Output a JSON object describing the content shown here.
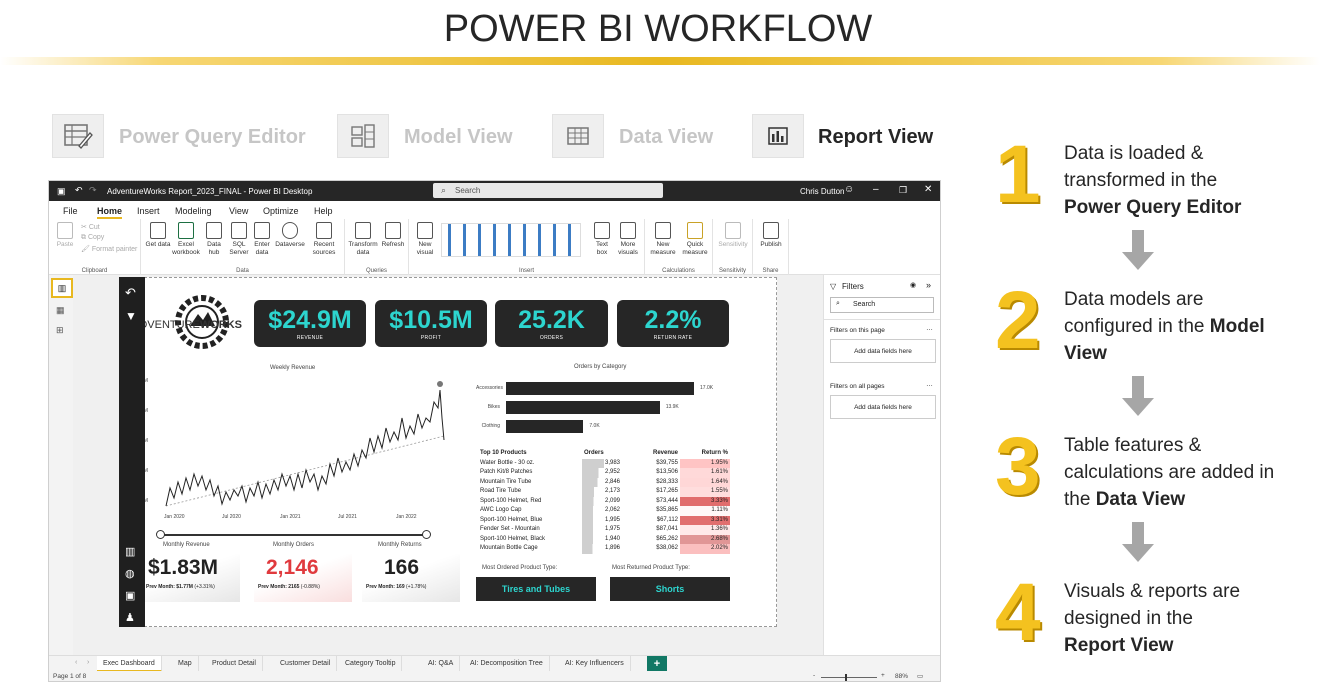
{
  "slide_title": "POWER BI WORKFLOW",
  "stages": [
    {
      "label": "Power Query Editor",
      "icon": "power-query-icon",
      "active": false
    },
    {
      "label": "Model View",
      "icon": "model-view-icon",
      "active": false
    },
    {
      "label": "Data View",
      "icon": "data-view-icon",
      "active": false
    },
    {
      "label": "Report View",
      "icon": "report-view-icon",
      "active": true
    }
  ],
  "steps": [
    {
      "num": "1",
      "pre": "Data is loaded & transformed in the",
      "bold": "Power Query Editor",
      "post": ""
    },
    {
      "num": "2",
      "pre": "Data models are configured in the",
      "bold": "Model View",
      "post": ""
    },
    {
      "num": "3",
      "pre": "Table features & calculations are added in the",
      "bold": "Data View",
      "post": ""
    },
    {
      "num": "4",
      "pre": "Visuals & reports are designed in the",
      "bold": "Report View",
      "post": ""
    }
  ],
  "accent_color": "#F4C21F",
  "window": {
    "title": "AdventureWorks Report_2023_FINAL - Power BI Desktop",
    "search_placeholder": "Search",
    "user": "Chris Dutton",
    "menu_tabs": [
      "File",
      "Home",
      "Insert",
      "Modeling",
      "View",
      "Optimize",
      "Help"
    ],
    "active_menu_tab": "Home",
    "ribbon": {
      "clipboard": {
        "paste": "Paste",
        "cut": "Cut",
        "copy": "Copy",
        "format_painter": "Format painter",
        "name": "Clipboard"
      },
      "data": {
        "buttons": [
          "Get data",
          "Excel workbook",
          "Data hub",
          "SQL Server",
          "Enter data",
          "Dataverse",
          "Recent sources"
        ],
        "name": "Data"
      },
      "queries": {
        "buttons": [
          "Transform data",
          "Refresh"
        ],
        "name": "Queries"
      },
      "insert": {
        "buttons": [
          "New visual",
          "Text box",
          "More visuals"
        ],
        "name": "Insert"
      },
      "calculations": {
        "buttons": [
          "New measure",
          "Quick measure"
        ],
        "name": "Calculations"
      },
      "sensitivity": {
        "buttons": [
          "Sensitivity"
        ],
        "name": "Sensitivity"
      },
      "share": {
        "buttons": [
          "Publish"
        ],
        "name": "Share"
      }
    },
    "report": {
      "logo_text_light": "ADVENTURE",
      "logo_text_bold": "WORKS",
      "kpis": [
        {
          "value": "$24.9M",
          "label": "REVENUE"
        },
        {
          "value": "$10.5M",
          "label": "PROFIT"
        },
        {
          "value": "25.2K",
          "label": "ORDERS"
        },
        {
          "value": "2.2%",
          "label": "RETURN RATE"
        }
      ],
      "weekly_revenue": {
        "title": "Weekly Revenue",
        "y_ticks": [
          "$0.5M",
          "$0.4M",
          "$0.3M",
          "$0.2M",
          "$0.1M"
        ],
        "x_ticks": [
          "Jan 2020",
          "Jul 2020",
          "Jan 2021",
          "Jul 2021",
          "Jan 2022"
        ]
      },
      "orders_by_category": {
        "title": "Orders by Category",
        "rows": [
          {
            "category": "Accessories",
            "value": 17.0,
            "label": "17.0K"
          },
          {
            "category": "Bikes",
            "value": 13.9,
            "label": "13.9K"
          },
          {
            "category": "Clothing",
            "value": 7.0,
            "label": "7.0K"
          }
        ]
      },
      "top_products": {
        "headers": [
          "Top 10 Products",
          "Orders",
          "Revenue",
          "Return %"
        ],
        "rows": [
          [
            "Water Bottle - 30 oz.",
            "3,983",
            "$39,755",
            "1.95%"
          ],
          [
            "Patch Kit/8 Patches",
            "2,952",
            "$13,506",
            "1.61%"
          ],
          [
            "Mountain Tire Tube",
            "2,846",
            "$28,333",
            "1.64%"
          ],
          [
            "Road Tire Tube",
            "2,173",
            "$17,265",
            "1.55%"
          ],
          [
            "Sport-100 Helmet, Red",
            "2,099",
            "$73,444",
            "3.33%"
          ],
          [
            "AWC Logo Cap",
            "2,062",
            "$35,865",
            "1.11%"
          ],
          [
            "Sport-100 Helmet, Blue",
            "1,995",
            "$67,112",
            "3.31%"
          ],
          [
            "Fender Set - Mountain",
            "1,975",
            "$87,041",
            "1.36%"
          ],
          [
            "Sport-100 Helmet, Black",
            "1,940",
            "$65,262",
            "2.68%"
          ],
          [
            "Mountain Bottle Cage",
            "1,896",
            "$38,062",
            "2.02%"
          ]
        ]
      },
      "monthly": [
        {
          "title": "Monthly Revenue",
          "value": "$1.83M",
          "prev_label": "Prev Month: $1.77M",
          "prev_delta": "(+3.31%)",
          "color": "#222222"
        },
        {
          "title": "Monthly Orders",
          "value": "2,146",
          "prev_label": "Prev Month: 2165",
          "prev_delta": "(-0.88%)",
          "color": "#e03a3e"
        },
        {
          "title": "Monthly Returns",
          "value": "166",
          "prev_label": "Prev Month: 169",
          "prev_delta": "(+1.78%)",
          "color": "#222222"
        }
      ],
      "most_ordered": {
        "title": "Most Ordered Product Type:",
        "value": "Tires and Tubes"
      },
      "most_returned": {
        "title": "Most Returned Product Type:",
        "value": "Shorts"
      }
    },
    "filters": {
      "title": "Filters",
      "search_placeholder": "Search",
      "on_page": "Filters on this page",
      "on_all": "Filters on all pages",
      "add_fields": "Add data fields here"
    },
    "page_tabs": [
      "Exec Dashboard",
      "Map",
      "Product Detail",
      "Customer Detail",
      "Category Tooltip",
      "AI: Q&A",
      "AI: Decomposition Tree",
      "AI: Key Influencers"
    ],
    "active_page_tab": "Exec Dashboard",
    "status": {
      "page": "Page 1 of 8",
      "zoom": "88%"
    }
  }
}
